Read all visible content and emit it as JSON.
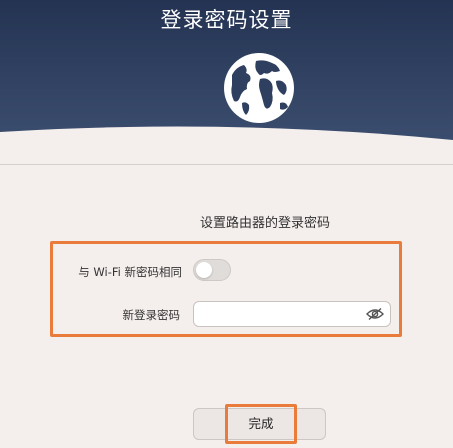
{
  "header": {
    "title": "登录密码设置",
    "bg_color": "#2c3d5c"
  },
  "globe_icon": "globe-icon",
  "form": {
    "subtitle": "设置路由器的登录密码",
    "same_as_wifi_label": "与 Wi-Fi 新密码相同",
    "same_as_wifi_on": false,
    "new_password_label": "新登录密码",
    "new_password_value": "",
    "eye_icon": "eye-off-icon"
  },
  "actions": {
    "done_label": "完成"
  },
  "highlight_color": "#e97c3b"
}
